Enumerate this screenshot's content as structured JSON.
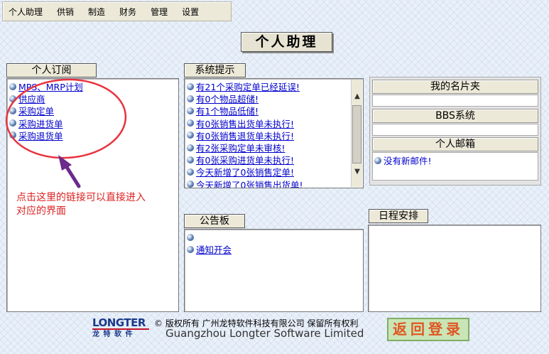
{
  "menu": [
    "个人助理",
    "供销",
    "制造",
    "财务",
    "管理",
    "设置"
  ],
  "page_title": "个人助理",
  "subscriptions": {
    "title": "个人订阅",
    "items": [
      "MPS、MRP计划",
      "供应商",
      "采购定单",
      "采购进货单",
      "采购退货单"
    ]
  },
  "system_tips": {
    "title": "系统提示",
    "items": [
      "有21个采购定单已经延误!",
      "有0个物品超储!",
      "有1个物品低储!",
      "有0张销售出货单未执行!",
      "有0张销售退货单未执行!",
      "有2张采购定单未审核!",
      "有0张采购进货单未执行!",
      "今天新增了0张销售定单!",
      "今天新增了0张销售出货单!"
    ]
  },
  "right_box": {
    "card_title": "我的名片夹",
    "bbs_title": "BBS系统",
    "mail_title": "个人邮箱",
    "mail_text": "没有新邮件!"
  },
  "bulletin": {
    "title": "公告板",
    "items": [
      "",
      "通知开会"
    ]
  },
  "schedule": {
    "title": "日程安排"
  },
  "annotation": {
    "line1": "点击这里的链接可以直接进入",
    "line2": "对应的界面"
  },
  "footer": {
    "logo_top": "LONGTER",
    "logo_bottom": "龙 特 软 件",
    "copyright": "© 版权所有  广州龙特软件科技有限公司  保留所有权利",
    "company_en": "Guangzhou Longter Software Limited",
    "return_label": "返回登录"
  },
  "colors": {
    "link": "#0000cc",
    "annotation": "#dd2222",
    "annotation_circle": "#e8333f",
    "arrow": "#6b2a8c"
  }
}
